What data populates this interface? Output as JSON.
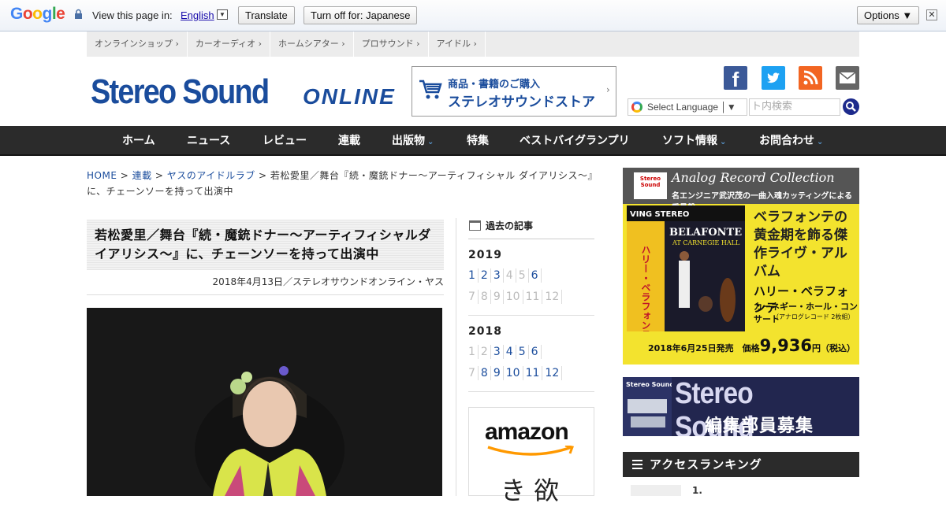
{
  "translate_bar": {
    "brand": "Google",
    "prompt": "View this page in:",
    "language": "English",
    "translate_btn": "Translate",
    "turn_off_btn": "Turn off for: Japanese",
    "options_btn": "Options ▼",
    "close": "✕"
  },
  "top_links": [
    "オンラインショップ",
    "カーオーディオ",
    "ホームシアター",
    "プロサウンド",
    "アイドル"
  ],
  "header": {
    "logo_main": "Stereo Sound",
    "logo_sub": "ONLINE",
    "store_line1": "商品・書籍のご購入",
    "store_line2": "ステレオサウンドストア",
    "translate_widget": "Select Language",
    "search_placeholder": "ト内検索"
  },
  "nav": [
    "ホーム",
    "ニュース",
    "レビュー",
    "連載",
    "出版物",
    "特集",
    "ベストバイグランプリ",
    "ソフト情報",
    "お問合わせ"
  ],
  "breadcrumb": {
    "home": "HOME",
    "series": "連載",
    "column": "ヤスのアイドルラブ",
    "current": "若松愛里／舞台『続・魔銃ドナー～アーティフィシャル ダイアリシス～』に、チェーンソーを持って出演中"
  },
  "article": {
    "title": "若松愛里／舞台『続・魔銃ドナー～アーティフィシャルダイアリシス～』に、チェーンソーを持って出演中",
    "date_author": "2018年4月13日／ステレオサウンドオンライン・ヤス"
  },
  "archive": {
    "heading": "過去の記事",
    "years": [
      {
        "year": "2019",
        "months": [
          "1",
          "2",
          "3",
          "4",
          "5",
          "6",
          "7",
          "8",
          "9",
          "10",
          "11",
          "12"
        ],
        "active": [
          1,
          2,
          3,
          6
        ]
      },
      {
        "year": "2018",
        "months": [
          "1",
          "2",
          "3",
          "4",
          "5",
          "6",
          "7",
          "8",
          "9",
          "10",
          "11",
          "12"
        ],
        "active": [
          3,
          4,
          5,
          6,
          8,
          9,
          10,
          11,
          12
        ]
      }
    ]
  },
  "amazon": {
    "wordmark": "amazon",
    "text": "き 欲"
  },
  "ad_record": {
    "header": "Analog Record Collection",
    "header_sub": "名エンジニア武沢茂の一曲入魂カッティングによる重量盤",
    "headline": "ベラフォンテの黄金期を飾る傑作ライヴ・アルバム",
    "product": "ハリー・ベラフォンテ",
    "product_sub": "カーネギー・ホール・コンサート",
    "format": "（アナログレコード 2枚組）",
    "release": "2018年6月25日発売　価格",
    "price": "9,936",
    "price_unit": "円（税込）"
  },
  "ad_recruit": {
    "line1": "Stereo Sound",
    "line2": "編集部員募集"
  },
  "ranking": {
    "heading": "アクセスランキング",
    "first": "1."
  }
}
